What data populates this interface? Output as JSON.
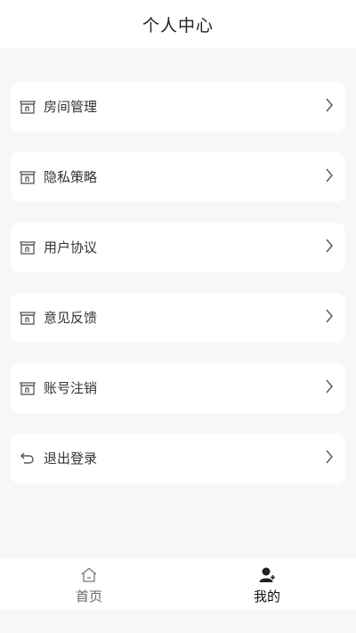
{
  "header": {
    "title": "个人中心"
  },
  "menu": {
    "items": [
      {
        "label": "房间管理",
        "icon": "store-icon"
      },
      {
        "label": "隐私策略",
        "icon": "store-icon"
      },
      {
        "label": "用户协议",
        "icon": "store-icon"
      },
      {
        "label": "意见反馈",
        "icon": "store-icon"
      },
      {
        "label": "账号注销",
        "icon": "store-icon"
      },
      {
        "label": "退出登录",
        "icon": "undo-arrow-icon"
      }
    ]
  },
  "tabbar": {
    "tabs": [
      {
        "label": "首页",
        "icon": "home-icon",
        "active": false
      },
      {
        "label": "我的",
        "icon": "user-icon",
        "active": true
      }
    ]
  },
  "colors": {
    "background": "#f7f7f7",
    "card": "#ffffff",
    "text": "#333333",
    "inactive_tab": "#666666",
    "active_tab": "#111111"
  }
}
